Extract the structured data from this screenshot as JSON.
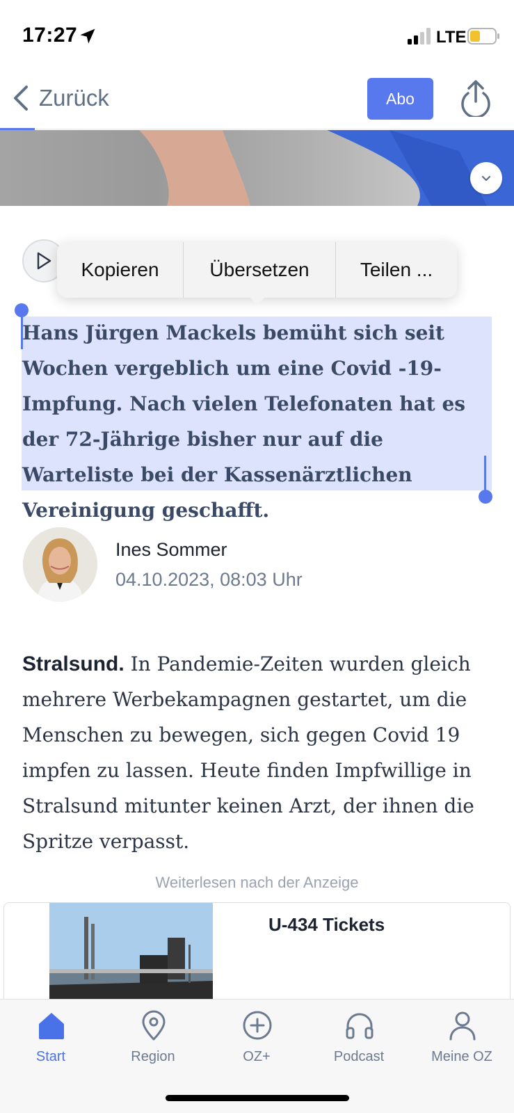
{
  "status_bar": {
    "time": "17:27",
    "network": "LTE",
    "icons": [
      "location-arrow-icon",
      "signal-icon",
      "battery-icon"
    ]
  },
  "nav": {
    "back_label": "Zurück",
    "subscribe_label": "Abo",
    "share_icon": "share-icon",
    "accent_color": "#5878ee"
  },
  "context_menu": {
    "items": [
      "Kopieren",
      "Übersetzen",
      "Teilen ..."
    ]
  },
  "article": {
    "lead": "Hans Jürgen Mackels bemüht sich seit Wochen vergeblich um eine Covid -19-Impfung. Nach vielen Telefonaten hat es der 72-Jährige bisher nur auf die Warteliste bei der Kassenärztlichen Vereinigung geschafft.",
    "author_name": "Ines Sommer",
    "date": "04.10.2023, 08:03 Uhr",
    "dateline": "Stralsund.",
    "body": " In Pandemie-Zeiten wurden gleich mehrere Werbekampagnen gestartet, um die Menschen zu bewegen, sich gegen Covid 19 impfen zu lassen. Heute finden Impfwillige in Stralsund mitunter keinen Arzt, der ihnen die Spritze verpasst.",
    "selection_color": "#dde3fd"
  },
  "ad": {
    "label": "Weiterlesen nach der Anzeige",
    "title": "U-434 Tickets"
  },
  "tab_bar": {
    "items": [
      {
        "label": "Start",
        "icon": "home-icon",
        "active": true
      },
      {
        "label": "Region",
        "icon": "map-pin-icon",
        "active": false
      },
      {
        "label": "OZ+",
        "icon": "plus-circle-icon",
        "active": false
      },
      {
        "label": "Podcast",
        "icon": "headphones-icon",
        "active": false
      },
      {
        "label": "Meine OZ",
        "icon": "user-icon",
        "active": false
      }
    ]
  }
}
